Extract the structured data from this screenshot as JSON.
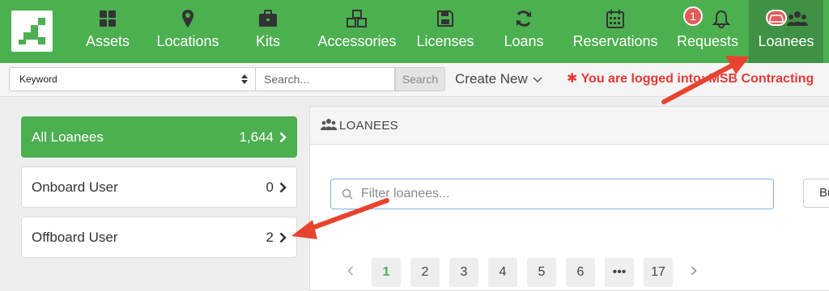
{
  "nav": {
    "items": [
      {
        "label": "Assets",
        "icon": "grid-icon"
      },
      {
        "label": "Locations",
        "icon": "map-marker-icon"
      },
      {
        "label": "Kits",
        "icon": "briefcase-icon"
      },
      {
        "label": "Accessories",
        "icon": "cubes-icon"
      },
      {
        "label": "Licenses",
        "icon": "floppy-disk-icon"
      },
      {
        "label": "Loans",
        "icon": "refresh-icon"
      },
      {
        "label": "Reservations",
        "icon": "calendar-icon"
      },
      {
        "label": "Requests",
        "icon": "bell-icon",
        "badge": "1"
      },
      {
        "label": "Loanees",
        "icon": "users-icon",
        "active": true
      }
    ]
  },
  "search": {
    "field_select": "Keyword",
    "placeholder": "Search...",
    "button": "Search",
    "create_new": "Create New",
    "logged_in": "✱ You are logged into: MSB Contracting"
  },
  "sidebar": {
    "items": [
      {
        "label": "All Loanees",
        "count": "1,644",
        "active": true
      },
      {
        "label": "Onboard User",
        "count": "0"
      },
      {
        "label": "Offboard User",
        "count": "2"
      }
    ]
  },
  "panel": {
    "title": "LOANEES",
    "filter_placeholder": "Filter loanees...",
    "side_button": "Bu"
  },
  "pagination": {
    "pages": [
      "1",
      "2",
      "3",
      "4",
      "5",
      "6",
      "•••",
      "17"
    ],
    "current": "1"
  },
  "colors": {
    "brand": "#4caf50",
    "alert": "#e53935",
    "annotation": "#e8432f"
  }
}
